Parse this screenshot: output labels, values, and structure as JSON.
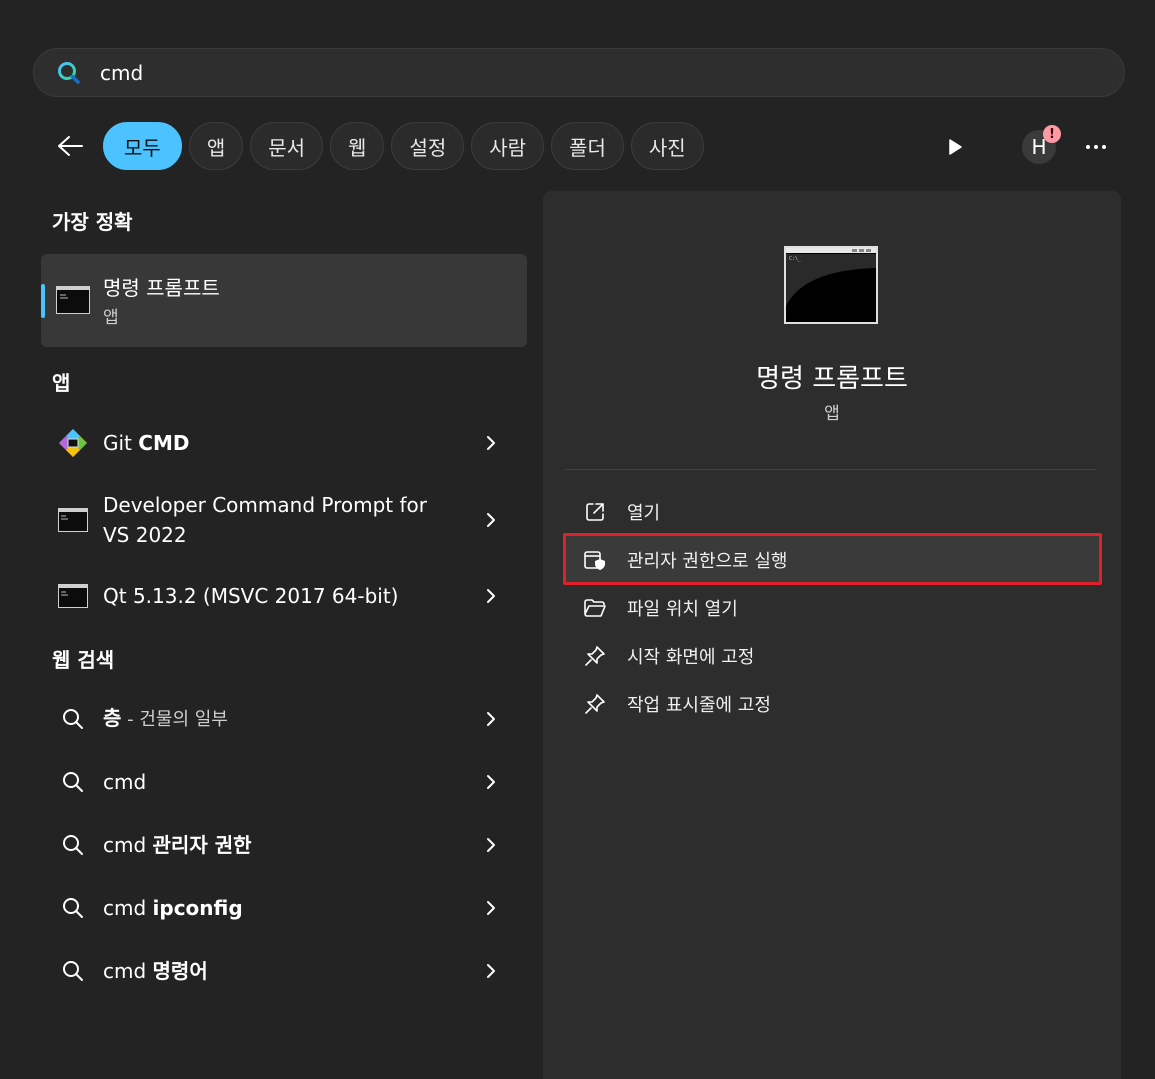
{
  "search": {
    "value": "cmd"
  },
  "filters": {
    "tabs": [
      "모두",
      "앱",
      "문서",
      "웹",
      "설정",
      "사람",
      "폴더",
      "사진"
    ],
    "avatar_letter": "H",
    "badge": "!"
  },
  "best_match": {
    "title": "가장 정확",
    "name": "명령 프롬프트",
    "type": "앱"
  },
  "apps": {
    "title": "앱",
    "items": [
      {
        "pre": "Git ",
        "bold": "CMD"
      },
      {
        "line1": "Developer Command Prompt for",
        "line2": "VS 2022"
      },
      {
        "text": "Qt 5.13.2 (MSVC 2017 64-bit)"
      }
    ]
  },
  "web": {
    "title": "웹 검색",
    "items": [
      {
        "bold": "층",
        "suffix": " - 건물의 일부"
      },
      {
        "pre": "cmd"
      },
      {
        "pre": "cmd ",
        "bold": "관리자 권한"
      },
      {
        "pre": "cmd ",
        "bold": "ipconfig"
      },
      {
        "pre": "cmd ",
        "bold": "명령어"
      }
    ]
  },
  "preview": {
    "name": "명령 프롬프트",
    "type": "앱",
    "console_text": "C:\\_",
    "actions": [
      "열기",
      "관리자 권한으로 실행",
      "파일 위치 열기",
      "시작 화면에 고정",
      "작업 표시줄에 고정"
    ]
  },
  "colors": {
    "accent": "#4cc2ff",
    "highlight_border": "#e0202a",
    "background": "#232323"
  }
}
